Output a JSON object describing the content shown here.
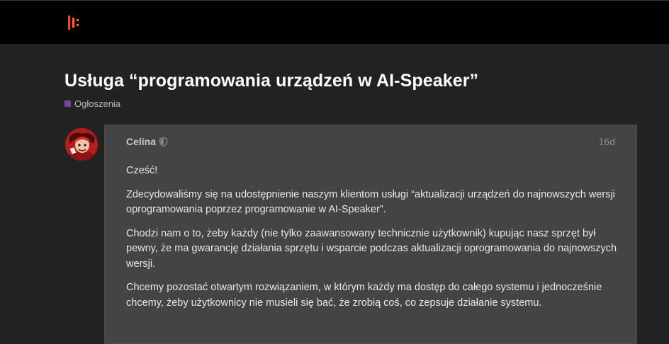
{
  "header": {
    "logo_icon": "site-logo-icon",
    "logo_colors": [
      "#e8482e",
      "#e8702e"
    ]
  },
  "topic": {
    "title": "Usługa “programowania urządzeń w AI-Speaker”",
    "category": {
      "label": "Ogłoszenia",
      "color": "#7b3fa8"
    }
  },
  "post": {
    "author": "Celina",
    "author_badge_icon": "shield-icon",
    "date": "16d",
    "paragraphs": [
      "Cześć!",
      "Zdecydowaliśmy się na udostępnienie naszym klientom usługi “aktualizacji urządzeń do najnowszych wersji oprogramowania poprzez programowanie w AI-Speaker”.",
      "Chodzi nam o to, żeby każdy (nie tylko zaawansowany technicznie użytkownik) kupując nasz sprzęt był pewny, że ma gwarancję działania sprzętu i wsparcie podczas aktualizacji oprogramowania do najnowszych wersji.",
      "Chcemy pozostać otwartym rozwiązaniem, w którym każdy ma dostęp do całego systemu i jednocześnie chcemy, żeby użytkownicy nie musieli się bać, że zrobią coś, co zepsuje działanie systemu."
    ]
  },
  "colors": {
    "header_bg": "#000000",
    "page_bg": "#222222",
    "post_bg": "#444444",
    "title": "#ffffff",
    "body_text": "#e8e8e8"
  }
}
